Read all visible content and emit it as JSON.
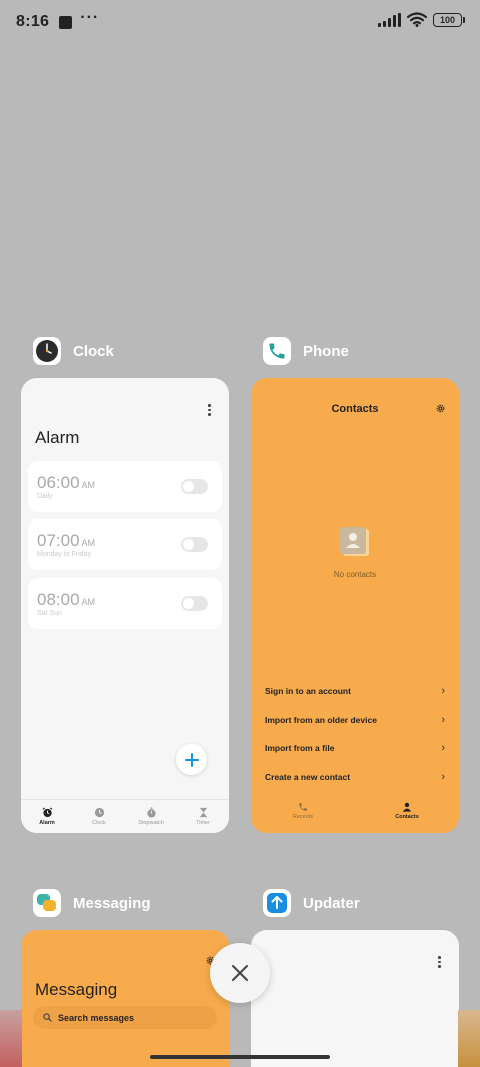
{
  "status_bar": {
    "time": "8:16",
    "battery": "100"
  },
  "apps": {
    "clock": {
      "name": "Clock",
      "title": "Alarm",
      "alarms": [
        {
          "time": "06:00",
          "ampm": "AM",
          "repeat": "Daily"
        },
        {
          "time": "07:00",
          "ampm": "AM",
          "repeat": "Monday to Friday"
        },
        {
          "time": "08:00",
          "ampm": "AM",
          "repeat": "Sat Sun"
        }
      ],
      "nav": [
        "Alarm",
        "Clock",
        "Stopwatch",
        "Timer"
      ]
    },
    "phone": {
      "name": "Phone",
      "title": "Contacts",
      "empty_text": "No contacts",
      "actions": [
        "Sign in to an account",
        "Import from an older device",
        "Import from a file",
        "Create a new contact"
      ],
      "nav": [
        "Recents",
        "Contacts"
      ]
    },
    "messaging": {
      "name": "Messaging",
      "title": "Messaging",
      "search_placeholder": "Search messages"
    },
    "updater": {
      "name": "Updater"
    }
  },
  "colors": {
    "background": "#b9b9b9",
    "orange_card": "#f7ab4c",
    "accent_blue": "#1a8fe0",
    "phone_teal": "#2aa198"
  }
}
